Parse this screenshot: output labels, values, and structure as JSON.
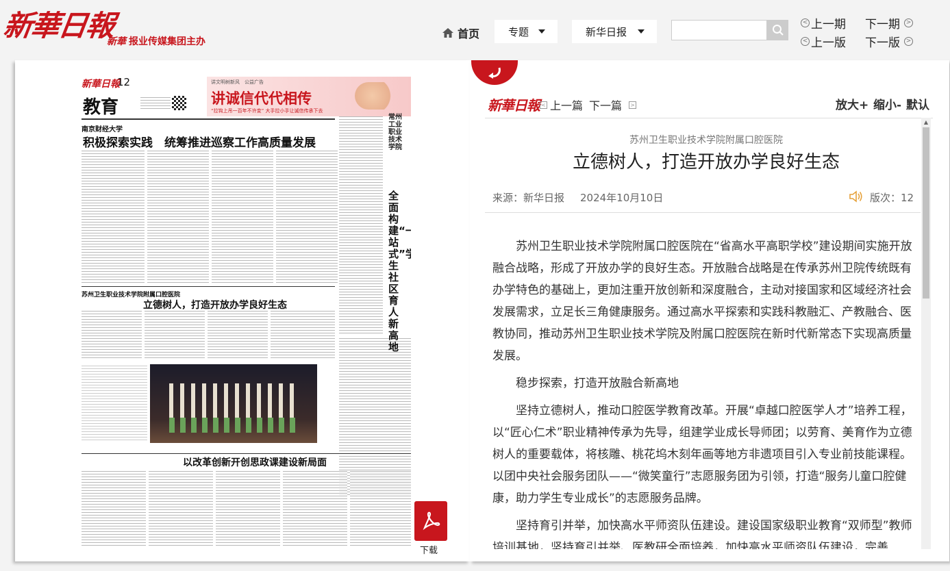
{
  "header": {
    "logo_text": "新華日報",
    "sublogo_mark": "新華",
    "sublogo_text": "报业传媒集团主办",
    "nav_home": "首页",
    "dropdown_topic": "专题",
    "dropdown_paper": "新华日报",
    "search_placeholder": "",
    "prev_issue": "上一期",
    "next_issue": "下一期",
    "prev_edition": "上一版",
    "next_edition": "下一版"
  },
  "newspaper": {
    "masthead": "新華日報",
    "page_no": "12",
    "section": "教育",
    "ad_small": "讲文明树新风　公益广告",
    "ad_title": "讲诚信代代相传",
    "ad_sub": "“拉钩上吊一百年不许变” 大手拉小手让诚信传承下去",
    "story1_kicker": "南京财经大学",
    "story1_title": "积极探索实践　统筹推进巡察工作高质量发展",
    "story2_kicker": "苏州卫生职业技术学院附属口腔医院",
    "story2_title": "立德树人，打造开放办学良好生态",
    "story3_title": "以改革创新开创思政课建设新局面",
    "vertical_kicker": "常州工业职业技术学院",
    "vertical_title": "全面构建“一站式”学生社区育人新高地",
    "download_label": "下载"
  },
  "article": {
    "logo": "新華日報",
    "prev_article": "上一篇",
    "next_article": "下一篇",
    "zoom_in": "放大+",
    "zoom_out": "缩小-",
    "zoom_default": "默认",
    "kicker": "苏州卫生职业技术学院附属口腔医院",
    "title": "立德树人，打造开放办学良好生态",
    "source": "来源：新华日报",
    "date": "2024年10月10日",
    "page": "版次：12",
    "paragraphs": [
      "苏州卫生职业技术学院附属口腔医院在“省高水平高职学校”建设期间实施开放融合战略，形成了开放办学的良好生态。开放融合战略是在传承苏州卫院传统既有办学特色的基础上，更加注重开放创新和深度融合，主动对接国家和区域经济社会发展需求，立足长三角健康服务。通过高水平探索和实践科教融汇、产教融合、医教协同，推动苏州卫生职业技术学院及附属口腔医院在新时代新常态下实现高质量发展。",
      "稳步探索，打造开放融合新高地",
      "坚持立德树人，推动口腔医学教育改革。开展“卓越口腔医学人才”培养工程，以“匠心仁术”职业精神传承为先导，组建学业成长导师团；以劳育、美育作为立德树人的重要载体，将核雕、桃花坞木刻年画等地方非遗项目引入专业前技能课程。以团中央社会服务团队——“微笑童行”志愿服务团为引领，打造“服务儿童口腔健康，助力学生专业成长”的志愿服务品牌。",
      "坚持育引并举，加快高水平师资队伍建设。建设国家级职业教育“双师型”教师培训基地，坚持育引并举、医教研全面培养，加快高水平师资队伍建设，完善"
    ]
  },
  "colors": {
    "brand_red": "#c8161d"
  }
}
